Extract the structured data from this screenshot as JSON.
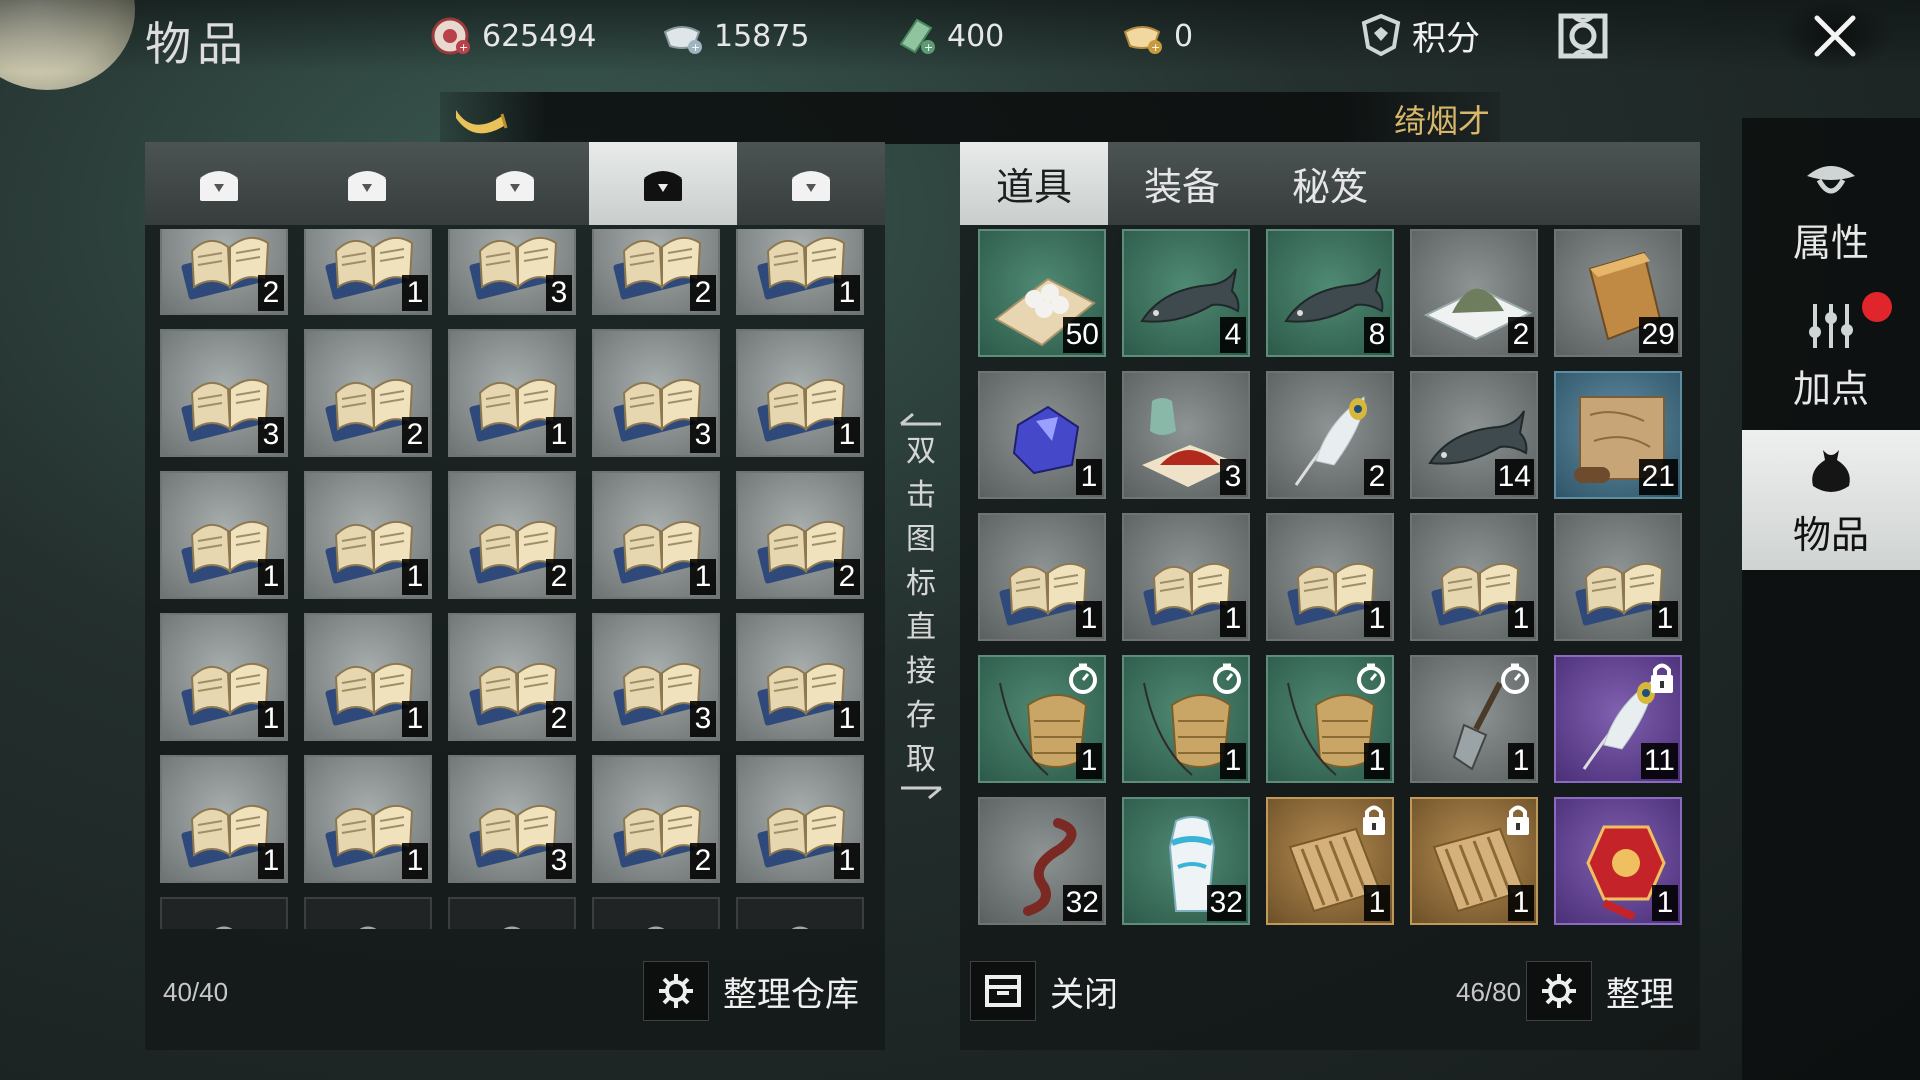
{
  "header": {
    "title": "物品",
    "currencies": [
      {
        "icon": "coin-gear-icon",
        "value": "625494"
      },
      {
        "icon": "silver-ingot-icon",
        "value": "15875"
      },
      {
        "icon": "jade-note-icon",
        "value": "400"
      },
      {
        "icon": "gold-ingot-icon",
        "value": "0"
      }
    ],
    "score_label": "积分"
  },
  "banner": {
    "text": "绮烟才"
  },
  "warehouse": {
    "chest_tabs": [
      "chest-tab-1",
      "chest-tab-2",
      "chest-tab-3",
      "chest-tab-4",
      "chest-tab-5"
    ],
    "active_tab_index": 3,
    "slots": [
      {
        "icon": "book-icon",
        "qty": "2"
      },
      {
        "icon": "book-icon",
        "qty": "1"
      },
      {
        "icon": "book-icon",
        "qty": "3"
      },
      {
        "icon": "book-icon",
        "qty": "2"
      },
      {
        "icon": "book-icon",
        "qty": "1"
      },
      {
        "icon": "book-icon",
        "qty": "3"
      },
      {
        "icon": "book-icon",
        "qty": "2"
      },
      {
        "icon": "book-icon",
        "qty": "1"
      },
      {
        "icon": "book-icon",
        "qty": "3"
      },
      {
        "icon": "book-icon",
        "qty": "1"
      },
      {
        "icon": "book-icon",
        "qty": "1"
      },
      {
        "icon": "book-icon",
        "qty": "1"
      },
      {
        "icon": "book-icon",
        "qty": "2"
      },
      {
        "icon": "book-icon",
        "qty": "1"
      },
      {
        "icon": "book-icon",
        "qty": "2"
      },
      {
        "icon": "book-icon",
        "qty": "1"
      },
      {
        "icon": "book-icon",
        "qty": "1"
      },
      {
        "icon": "book-icon",
        "qty": "2"
      },
      {
        "icon": "book-icon",
        "qty": "3"
      },
      {
        "icon": "book-icon",
        "qty": "1"
      },
      {
        "icon": "book-icon",
        "qty": "1"
      },
      {
        "icon": "book-icon",
        "qty": "1"
      },
      {
        "icon": "book-icon",
        "qty": "3"
      },
      {
        "icon": "book-icon",
        "qty": "2"
      },
      {
        "icon": "book-icon",
        "qty": "1"
      }
    ],
    "capacity": "40/40",
    "organize_label": "整理仓库"
  },
  "hint_text": [
    "双",
    "击",
    "图",
    "标",
    "直",
    "接",
    "存",
    "取"
  ],
  "bag": {
    "tabs": [
      "道具",
      "装备",
      "秘笈"
    ],
    "active_tab_index": 0,
    "slots": [
      {
        "icon": "pearls-icon",
        "qty": "50",
        "rarity": "green"
      },
      {
        "icon": "fish-icon",
        "qty": "4",
        "rarity": "green"
      },
      {
        "icon": "fish-icon",
        "qty": "8",
        "rarity": "green"
      },
      {
        "icon": "powder-pile-icon",
        "qty": "2",
        "rarity": "grey"
      },
      {
        "icon": "gold-bar-icon",
        "qty": "29",
        "rarity": "grey"
      },
      {
        "icon": "sapphire-ore-icon",
        "qty": "1",
        "rarity": "grey"
      },
      {
        "icon": "red-powder-vase-icon",
        "qty": "3",
        "rarity": "grey"
      },
      {
        "icon": "peacock-feather-icon",
        "qty": "2",
        "rarity": "grey"
      },
      {
        "icon": "fish-icon",
        "qty": "14",
        "rarity": "grey"
      },
      {
        "icon": "map-scroll-icon",
        "qty": "21",
        "rarity": "blue"
      },
      {
        "icon": "book-icon",
        "qty": "1",
        "rarity": "grey"
      },
      {
        "icon": "book-icon",
        "qty": "1",
        "rarity": "grey"
      },
      {
        "icon": "book-icon",
        "qty": "1",
        "rarity": "grey"
      },
      {
        "icon": "book-icon",
        "qty": "1",
        "rarity": "grey"
      },
      {
        "icon": "book-icon",
        "qty": "1",
        "rarity": "grey"
      },
      {
        "icon": "fishing-basket-icon",
        "qty": "1",
        "rarity": "green",
        "badge": "timer-icon"
      },
      {
        "icon": "fishing-basket-icon",
        "qty": "1",
        "rarity": "green",
        "badge": "timer-icon"
      },
      {
        "icon": "fishing-basket-icon",
        "qty": "1",
        "rarity": "green",
        "badge": "timer-icon"
      },
      {
        "icon": "shovel-icon",
        "qty": "1",
        "rarity": "grey",
        "badge": "timer-icon"
      },
      {
        "icon": "peacock-feather-icon",
        "qty": "11",
        "rarity": "purple",
        "badge": "lock-icon"
      },
      {
        "icon": "earthworm-icon",
        "qty": "32",
        "rarity": "grey"
      },
      {
        "icon": "costume-icon",
        "qty": "32",
        "rarity": "green"
      },
      {
        "icon": "bamboo-scroll-icon",
        "qty": "1",
        "rarity": "gold",
        "badge": "lock-icon"
      },
      {
        "icon": "bamboo-scroll-icon",
        "qty": "1",
        "rarity": "gold",
        "badge": "lock-icon"
      },
      {
        "icon": "red-lantern-icon",
        "qty": "1",
        "rarity": "purple"
      }
    ],
    "close_label": "关闭",
    "capacity": "46/80",
    "organize_label": "整理"
  },
  "side_nav": [
    {
      "label": "属性",
      "icon": "hat-icon"
    },
    {
      "label": "加点",
      "icon": "sliders-icon",
      "notify": true
    },
    {
      "label": "物品",
      "icon": "pouch-icon",
      "active": true
    }
  ],
  "colors": {
    "accent_gold": "#d9b76a",
    "notify_red": "#e0252b",
    "active_tab": "#e8ebea"
  }
}
